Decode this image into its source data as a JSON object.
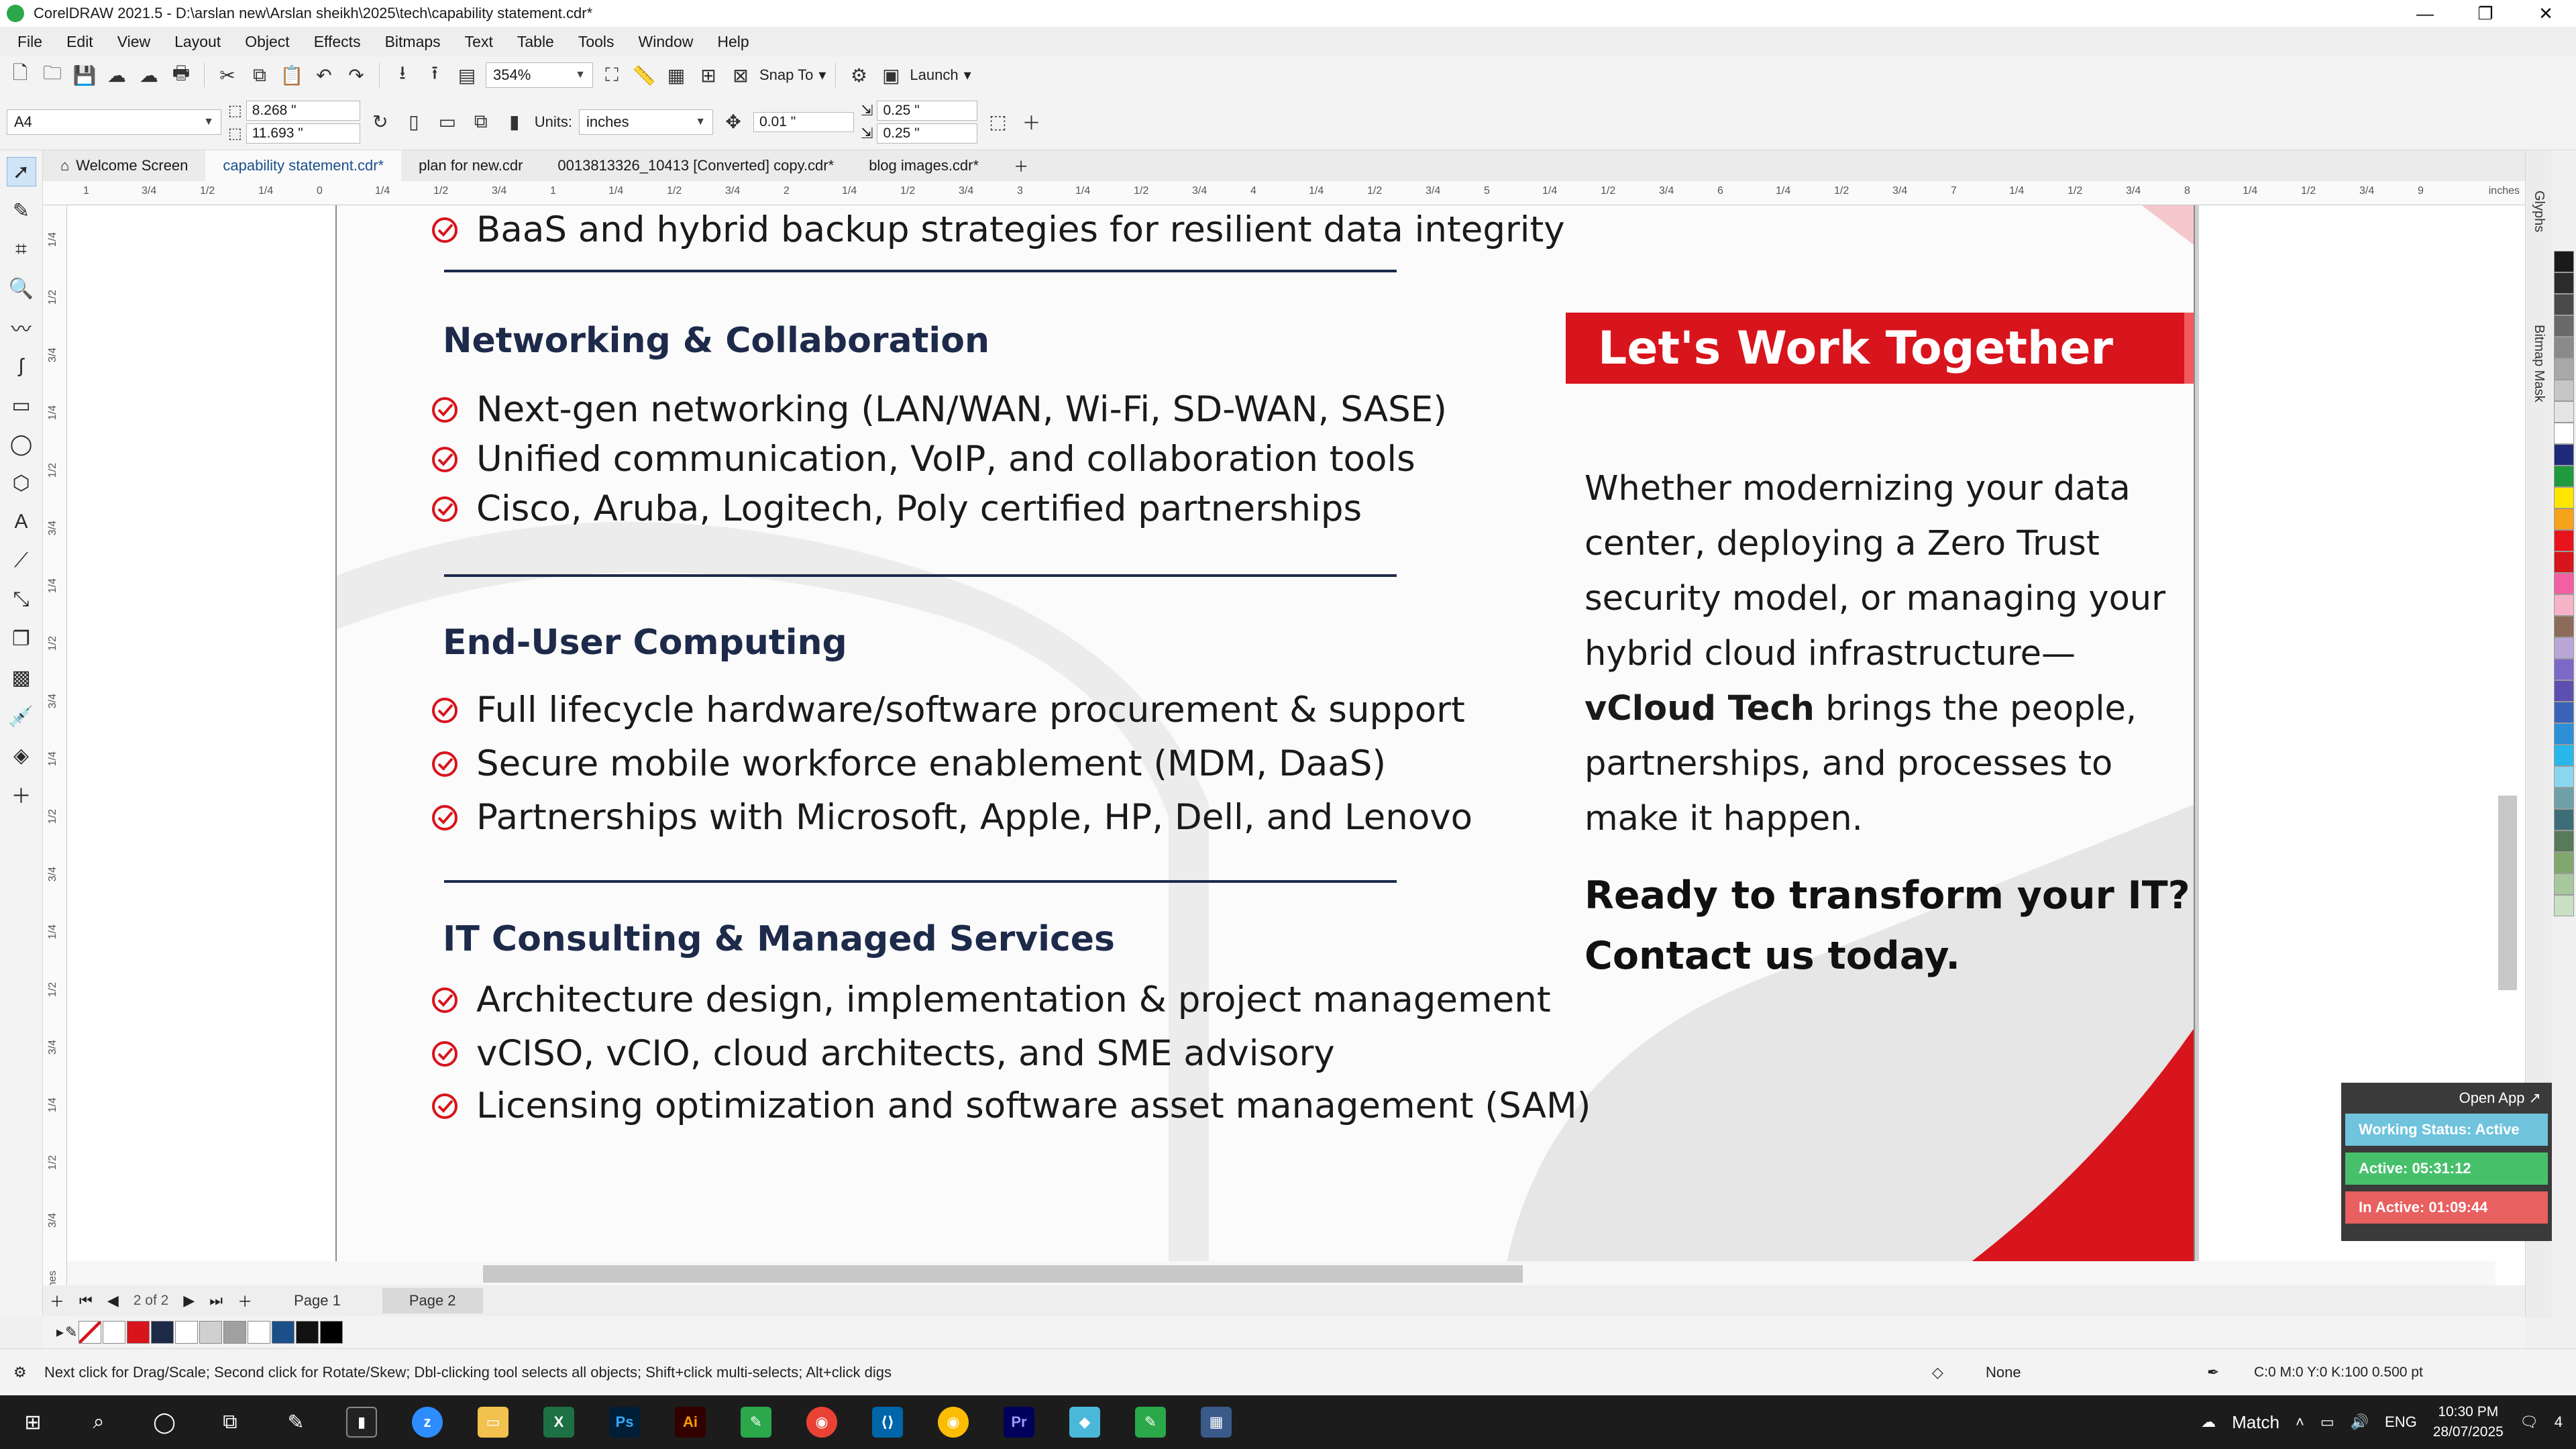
{
  "window": {
    "title": "CorelDRAW 2021.5 - D:\\arslan new\\Arslan sheikh\\2025\\tech\\capability statement.cdr*",
    "controls": [
      "—",
      "❐",
      "✕"
    ]
  },
  "menu": [
    "File",
    "Edit",
    "View",
    "Layout",
    "Object",
    "Effects",
    "Bitmaps",
    "Text",
    "Table",
    "Tools",
    "Window",
    "Help"
  ],
  "toolbar": {
    "zoom": "354%",
    "snap_to": "Snap To",
    "launch": "Launch"
  },
  "property_bar": {
    "page_size": "A4",
    "width": "8.268 \"",
    "height": "11.693 \"",
    "units_label": "Units:",
    "units": "inches",
    "nudge": "0.01 \"",
    "dup_x": "0.25 \"",
    "dup_y": "0.25 \""
  },
  "doc_tabs": [
    {
      "label": "Welcome Screen",
      "home": true
    },
    {
      "label": "capability statement.cdr*",
      "active": true
    },
    {
      "label": "plan for new.cdr"
    },
    {
      "label": "0013813326_10413 [Converted] copy.cdr*"
    },
    {
      "label": "blog images.cdr*"
    }
  ],
  "ruler": {
    "h_ticks": [
      "1",
      "3/4",
      "1/2",
      "1/4",
      "0",
      "1/4",
      "1/2",
      "3/4",
      "1",
      "1/4",
      "1/2",
      "3/4",
      "2",
      "1/4",
      "1/2",
      "3/4",
      "3",
      "1/4",
      "1/2",
      "3/4",
      "4",
      "1/4",
      "1/2",
      "3/4",
      "5",
      "1/4",
      "1/2",
      "3/4",
      "6",
      "1/4",
      "1/2",
      "3/4",
      "7",
      "1/4",
      "1/2",
      "3/4",
      "8",
      "1/4",
      "1/2",
      "3/4",
      "9"
    ],
    "unit": "inches",
    "v_ticks": [
      "1/4",
      "1/2",
      "3/4",
      "1/4",
      "1/2",
      "3/4",
      "1/4",
      "1/2",
      "3/4",
      "1/4",
      "1/2",
      "3/4",
      "1/4",
      "1/2",
      "3/4",
      "1/4",
      "1/2",
      "3/4",
      "inches"
    ]
  },
  "document": {
    "top_bullet": "BaaS and hybrid backup strategies for resilient data integrity",
    "sections": [
      {
        "heading": "Networking & Collaboration",
        "bullets": [
          "Next-gen networking (LAN/WAN, Wi-Fi, SD-WAN, SASE)",
          "Unified communication, VoIP, and collaboration tools",
          "Cisco, Aruba, Logitech, Poly certified partnerships"
        ]
      },
      {
        "heading": "End-User Computing",
        "bullets": [
          "Full lifecycle hardware/software procurement & support",
          "Secure mobile workforce enablement (MDM, DaaS)",
          "Partnerships with Microsoft, Apple, HP, Dell, and Lenovo"
        ]
      },
      {
        "heading": "IT Consulting & Managed Services",
        "bullets": [
          "Architecture design, implementation & project management",
          "vCISO, vCIO, cloud architects, and SME advisory",
          "Licensing optimization and software asset management (SAM)"
        ]
      }
    ],
    "banner": "Let's Work Together",
    "para_before": "Whether modernizing your data center, deploying a Zero Trust security model, or managing your hybrid cloud infrastructure—",
    "para_bold": "vCloud Tech",
    "para_after": " brings the people, partnerships, and processes to make it happen.",
    "cta_line1": "Ready to transform your IT?",
    "cta_line2": "Contact us today.",
    "accent": "#d8141c",
    "navy": "#1d2a4a"
  },
  "dockers": [
    "Glyphs",
    "Bitmap Mask"
  ],
  "page_nav": {
    "position": "2",
    "of": "of",
    "total": "2",
    "pages": [
      "Page 1",
      "Page 2"
    ],
    "active_page": "Page 2"
  },
  "status": {
    "hint": "Next click for Drag/Scale; Second click for Rotate/Skew; Dbl-clicking tool selects all objects; Shift+click multi-selects; Alt+click digs",
    "fill": "None",
    "outline": "C:0 M:0 Y:0 K:100  0.500 pt"
  },
  "tracker": {
    "open_app": "Open App ↗",
    "working_status": "Working Status: Active",
    "active": "Active: 05:31:12",
    "inactive": "In Active: 01:09:44"
  },
  "taskbar": {
    "apps": [
      "start",
      "search",
      "cortana",
      "task-view",
      "pen",
      "terminal",
      "zoom",
      "explorer",
      "excel",
      "photoshop",
      "illustrator",
      "coreldraw",
      "chrome",
      "vscode",
      "chrome-profile",
      "premiere",
      "app",
      "coreldraw-active",
      "calculator"
    ],
    "weather": "Match",
    "lang": "ENG",
    "time": "10:30 PM",
    "date": "28/07/2025",
    "notifications": "4"
  },
  "palette_colors": [
    "#1a1a1a",
    "#2b2b2b",
    "#4a4a4a",
    "#6a6a6a",
    "#8a8a8a",
    "#a8a8a8",
    "#c6c6c6",
    "#e4e4e4",
    "#ffffff",
    "#1e2a78",
    "#1f9a3e",
    "#ffe600",
    "#f7a21b",
    "#e8141c",
    "#d8141c",
    "#f45fa1",
    "#f6b3c8",
    "#8c6b5a",
    "#b9a6d6",
    "#7b68c9",
    "#5d4fb0",
    "#3a63b8",
    "#2c8fd8",
    "#29b6e8",
    "#8ad6ef",
    "#6ea0a8",
    "#3d6e78",
    "#587a58",
    "#7fa76e",
    "#a7c79d",
    "#c9e0c3"
  ],
  "doc_palette": [
    "#ffffff",
    "#d8141c",
    "#1d2a4a",
    "#ffffff",
    "#d0d0d0",
    "#a0a0a0",
    "#ffffff",
    "#1a4f8a",
    "#111111",
    "#000000"
  ]
}
